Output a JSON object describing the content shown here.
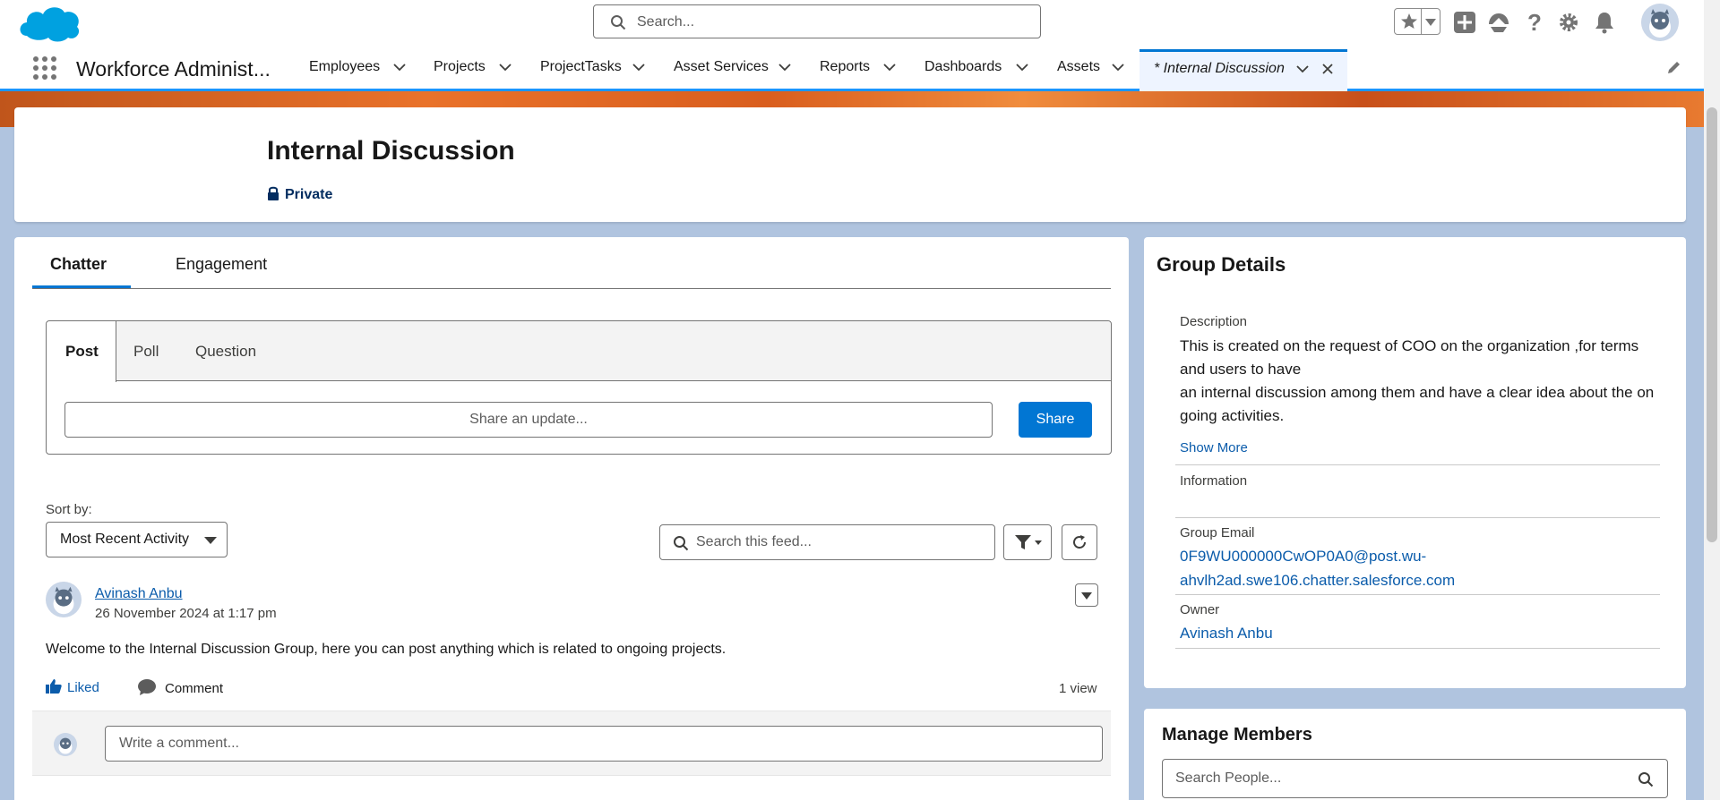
{
  "header": {
    "search_placeholder": "Search..."
  },
  "nav": {
    "app_name": "Workforce Administ...",
    "items": [
      {
        "label": "Employees"
      },
      {
        "label": "Projects"
      },
      {
        "label": "ProjectTasks"
      },
      {
        "label": "Asset Services"
      },
      {
        "label": "Reports"
      },
      {
        "label": "Dashboards"
      },
      {
        "label": "Assets"
      }
    ],
    "active_tab": "* Internal Discussion"
  },
  "group": {
    "title": "Internal Discussion",
    "visibility": "Private"
  },
  "feed": {
    "tabs": [
      "Chatter",
      "Engagement"
    ],
    "publisher_tabs": [
      "Post",
      "Poll",
      "Question"
    ],
    "share_placeholder": "Share an update...",
    "share_button": "Share",
    "sort_label": "Sort by:",
    "sort_value": "Most Recent Activity",
    "search_placeholder": "Search this feed...",
    "post": {
      "author": "Avinash Anbu",
      "date": "26 November 2024 at 1:17 pm",
      "body": "Welcome to the Internal Discussion Group, here you can post anything which is related to ongoing projects.",
      "liked_label": "Liked",
      "comment_label": "Comment",
      "views": "1 view",
      "comment_placeholder": "Write a comment..."
    }
  },
  "details": {
    "title": "Group Details",
    "description_label": "Description",
    "description_line1": "This is created on the request of COO on the organization ,for terms and users to have",
    "description_line2": "an internal discussion among them and have a clear idea about the on going activities.",
    "show_more": "Show More",
    "information_label": "Information",
    "email_label": "Group Email",
    "email_line1": "0F9WU000000CwOP0A0@post.wu-",
    "email_line2": "ahvlh2ad.swe106.chatter.salesforce.com",
    "owner_label": "Owner",
    "owner": "Avinash Anbu"
  },
  "members": {
    "title": "Manage Members",
    "search_placeholder": "Search People..."
  },
  "colors": {
    "brand": "#0176d3",
    "link": "#0b5cab",
    "background": "#b0c4df"
  }
}
